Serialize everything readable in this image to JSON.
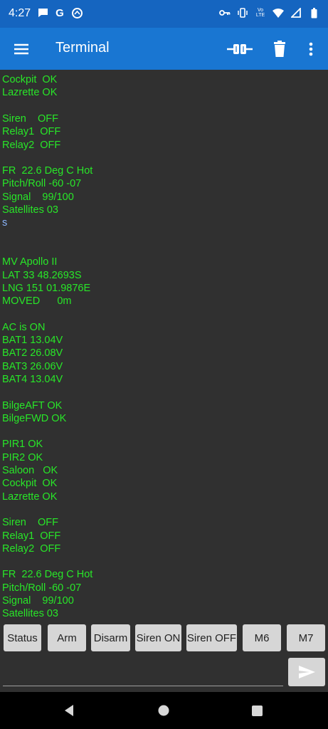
{
  "status_bar": {
    "time": "4:27",
    "left_icons": [
      "chat-bubble-icon",
      "google-icon",
      "browser-icon"
    ],
    "right_icons": [
      "vpn-key-icon",
      "vibrate-icon",
      "volte-icon",
      "wifi-icon",
      "signal-icon",
      "battery-icon"
    ],
    "volte_label": "Vo\nLTE"
  },
  "app_bar": {
    "title": "Terminal",
    "background": "#1976d2"
  },
  "terminal": {
    "text_color": "#28e628",
    "lines": [
      "Cockpit  OK",
      "Lazrette OK",
      "",
      "Siren    OFF",
      "Relay1  OFF",
      "Relay2  OFF",
      "",
      "FR  22.6 Deg C Hot",
      "Pitch/Roll -60 -07",
      "Signal    99/100",
      "Satellites 03",
      "s",
      "",
      "",
      "MV Apollo II",
      "LAT 33 48.2693S",
      "LNG 151 01.9876E",
      "MOVED      0m",
      "",
      "AC is ON",
      "BAT1 13.04V",
      "BAT2 26.08V",
      "BAT3 26.06V",
      "BAT4 13.04V",
      "",
      "BilgeAFT OK",
      "BilgeFWD OK",
      "",
      "PIR1 OK",
      "PIR2 OK",
      "Saloon   OK",
      "Cockpit  OK",
      "Lazrette OK",
      "",
      "Siren    OFF",
      "Relay1  OFF",
      "Relay2  OFF",
      "",
      "FR  22.6 Deg C Hot",
      "Pitch/Roll -60 -07",
      "Signal    99/100",
      "Satellites 03"
    ]
  },
  "macros": [
    "Status",
    "Arm",
    "Disarm",
    "Siren ON",
    "Siren OFF",
    "M6",
    "M7"
  ],
  "input": {
    "value": "",
    "placeholder": ""
  },
  "send_button": {
    "icon": "send-icon"
  },
  "nav_bar": {
    "icons": [
      "back-icon",
      "home-icon",
      "recents-icon"
    ]
  }
}
